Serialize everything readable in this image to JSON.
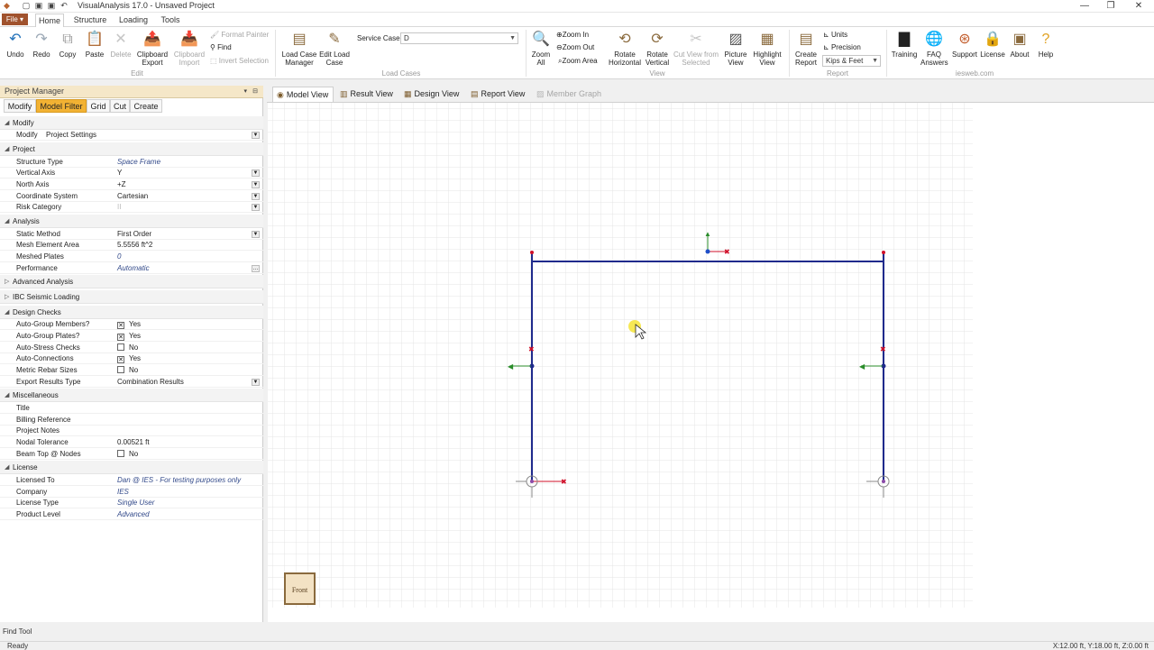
{
  "window": {
    "title": "VisualAnalysis 17.0 - Unsaved Project",
    "controls": {
      "minimize": "—",
      "maximize": "❐",
      "close": "✕"
    }
  },
  "quick_access": {
    "new": "▢",
    "save": "▣",
    "undo": "↶"
  },
  "menu": {
    "file": "File ▾",
    "tabs": [
      "Home",
      "Structure",
      "Loading",
      "Tools"
    ]
  },
  "ribbon": {
    "edit": {
      "undo": "Undo",
      "redo": "Redo",
      "copy": "Copy",
      "paste": "Paste",
      "delete": "Delete",
      "clipboard_export": "Clipboard Export",
      "clipboard_import": "Clipboard Import",
      "format_painter": "Format Painter",
      "find": "Find",
      "invert_selection": "Invert Selection",
      "group": "Edit"
    },
    "load_cases": {
      "manager": "Load Case Manager",
      "edit": "Edit Load Case",
      "service_case_label": "Service Case",
      "service_case_value": "D",
      "group": "Load Cases"
    },
    "view": {
      "zoom_all": "Zoom All",
      "zoom_in": "Zoom In",
      "zoom_out": "Zoom Out",
      "zoom_area": "Zoom Area",
      "rotate_horizontal": "Rotate Horizontal",
      "rotate_vertical": "Rotate Vertical",
      "cut_view": "Cut View from Selected",
      "picture_view": "Picture View",
      "highlight_view": "Highlight View",
      "group": "View"
    },
    "report": {
      "create_report": "Create Report",
      "units": "Units",
      "precision": "Precision",
      "units_value": "Kips & Feet",
      "group": "Report"
    },
    "iesweb": {
      "training": "Training",
      "faq": "FAQ Answers",
      "support": "Support",
      "license": "License",
      "about": "About",
      "help": "Help",
      "group": "iesweb.com"
    }
  },
  "project_manager": {
    "title": "Project Manager",
    "tabs": [
      "Modify",
      "Model Filter",
      "Grid",
      "Cut",
      "Create"
    ],
    "modify_row": {
      "label": "Modify",
      "value": "Project Settings"
    },
    "categories": {
      "modify": "Modify",
      "project": "Project",
      "analysis": "Analysis",
      "advanced": "Advanced Analysis",
      "ibc": "IBC Seismic Loading",
      "design": "Design Checks",
      "misc": "Miscellaneous",
      "license": "License"
    },
    "project": [
      {
        "label": "Structure Type",
        "value": "Space Frame"
      },
      {
        "label": "Vertical Axis",
        "value": "Y"
      },
      {
        "label": "North Axis",
        "value": "+Z"
      },
      {
        "label": "Coordinate System",
        "value": "Cartesian"
      },
      {
        "label": "Risk Category",
        "value": "II"
      }
    ],
    "analysis": [
      {
        "label": "Static Method",
        "value": "First Order"
      },
      {
        "label": "Mesh Element Area",
        "value": "5.5556 ft^2"
      },
      {
        "label": "Meshed Plates",
        "value": "0"
      },
      {
        "label": "Performance",
        "value": "Automatic"
      }
    ],
    "design": [
      {
        "label": "Auto-Group Members?",
        "value": "Yes",
        "checked": true
      },
      {
        "label": "Auto-Group Plates?",
        "value": "Yes",
        "checked": true
      },
      {
        "label": "Auto-Stress Checks",
        "value": "No",
        "checked": false
      },
      {
        "label": "Auto-Connections",
        "value": "Yes",
        "checked": true
      },
      {
        "label": "Metric Rebar Sizes",
        "value": "No",
        "checked": false
      },
      {
        "label": "Export Results Type",
        "value": "Combination Results"
      }
    ],
    "misc": [
      {
        "label": "Title",
        "value": ""
      },
      {
        "label": "Billing Reference",
        "value": ""
      },
      {
        "label": "Project Notes",
        "value": ""
      },
      {
        "label": "Nodal Tolerance",
        "value": "0.00521 ft"
      },
      {
        "label": "Beam Top @ Nodes",
        "value": "No",
        "checked": false
      }
    ],
    "license": [
      {
        "label": "Licensed To",
        "value": "Dan @ IES - For testing purposes only"
      },
      {
        "label": "Company",
        "value": "IES"
      },
      {
        "label": "License Type",
        "value": "Single User"
      },
      {
        "label": "Product Level",
        "value": "Advanced"
      }
    ]
  },
  "view_tabs": [
    "Model View",
    "Result View",
    "Design View",
    "Report View",
    "Member Graph"
  ],
  "canvas": {
    "orientation_label": "Front"
  },
  "find_tool": "Find Tool",
  "status": {
    "left": "Ready",
    "right": "X:12.00 ft, Y:18.00 ft, Z:0.00 ft"
  },
  "colors": {
    "accent": "#f2b233",
    "member": "#1f2a8c",
    "node": "#d0102a"
  }
}
